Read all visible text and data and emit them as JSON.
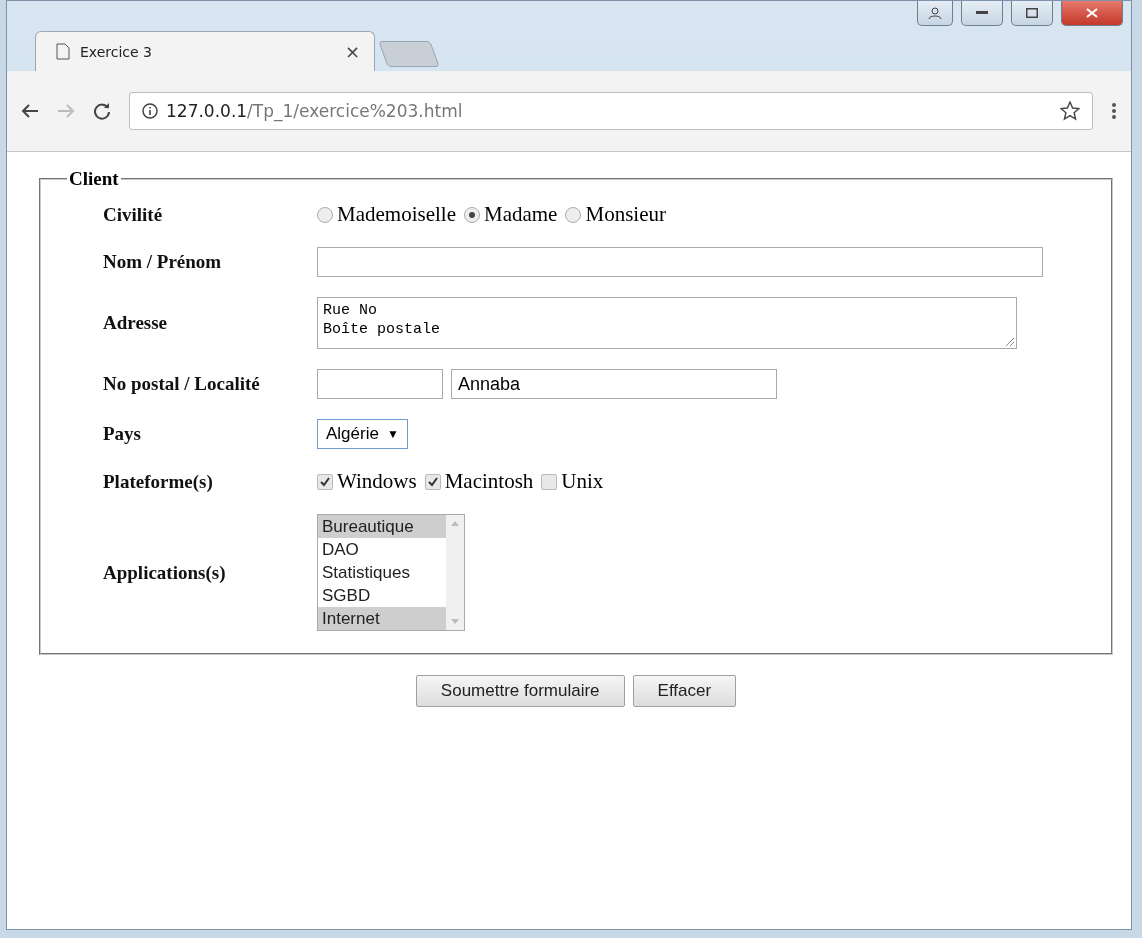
{
  "browser": {
    "tab_title": "Exercice 3",
    "tab_close": "×",
    "url_host": "127.0.0.1",
    "url_path": "/Tp_1/exercice%203.html"
  },
  "form": {
    "legend": "Client",
    "rows": [
      {
        "kind": "radio",
        "label": "Civilité",
        "options": [
          {
            "label": "Mademoiselle",
            "selected": false
          },
          {
            "label": "Madame",
            "selected": true
          },
          {
            "label": "Monsieur",
            "selected": false
          }
        ]
      },
      {
        "kind": "text",
        "label": "Nom / Prénom"
      },
      {
        "kind": "textarea",
        "label": "Adresse",
        "value_lines": [
          "Rue No",
          "Boîte postale"
        ]
      },
      {
        "kind": "postal",
        "label": "No postal / Localité",
        "city": "Annaba"
      },
      {
        "kind": "select",
        "label": "Pays",
        "value": "Algérie",
        "arrow": "▼"
      },
      {
        "kind": "checkbox",
        "label": "Plateforme(s)",
        "options": [
          {
            "label": "Windows",
            "checked": true
          },
          {
            "label": "Macintosh",
            "checked": true
          },
          {
            "label": "Unix",
            "checked": false
          }
        ]
      },
      {
        "kind": "listbox",
        "label": "Applications(s)",
        "options": [
          {
            "label": "Bureautique",
            "selected": true
          },
          {
            "label": "DAO",
            "selected": false
          },
          {
            "label": "Statistiques",
            "selected": false
          },
          {
            "label": "SGBD",
            "selected": false
          },
          {
            "label": "Internet",
            "selected": true
          }
        ]
      }
    ]
  },
  "buttons": [
    "Soumettre formulaire",
    "Effacer"
  ]
}
